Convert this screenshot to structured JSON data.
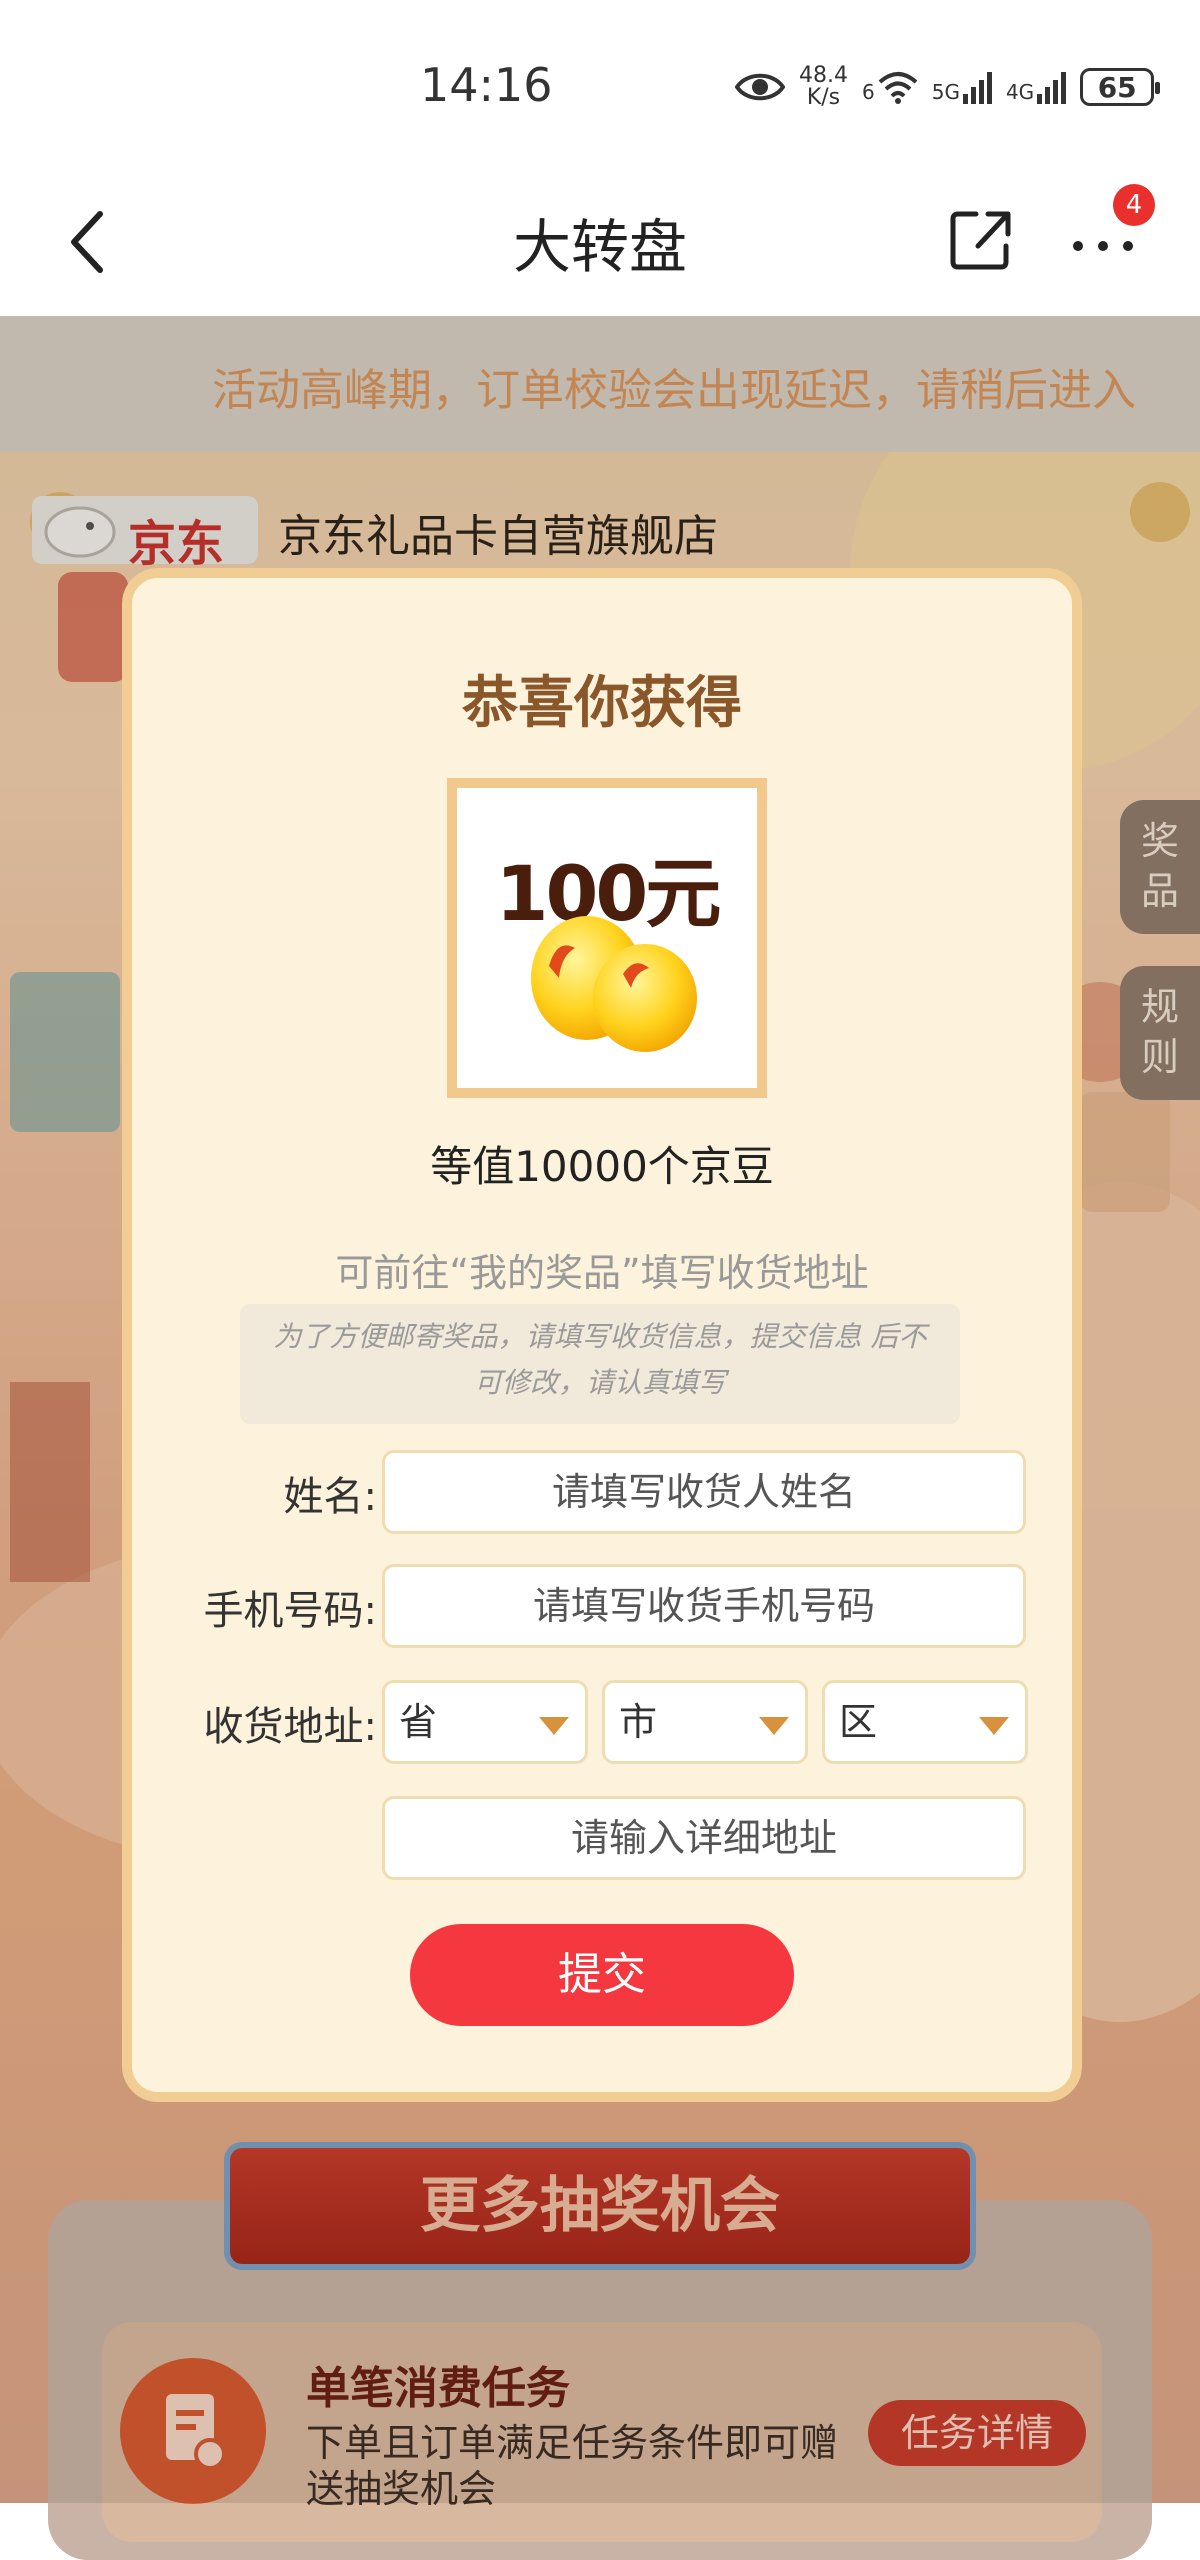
{
  "status_bar": {
    "time": "14:16",
    "net_speed_value": "48.4",
    "net_speed_unit": "K/s",
    "wifi_label": "6",
    "sim1_label": "5G",
    "sim2_label": "4G",
    "battery": "65"
  },
  "nav": {
    "title": "大转盘",
    "badge_count": "4"
  },
  "notice": {
    "text": "活动高峰期，订单校验会出现延迟，请稍后进入"
  },
  "store": {
    "logo_text": "京东",
    "name": "京东礼品卡自营旗舰店"
  },
  "side_tabs": {
    "prizes": "奖品",
    "rules": "规则"
  },
  "modal": {
    "title": "恭喜你获得",
    "prize_amount": "100元",
    "prize_desc": "等值10000个京豆",
    "hint": "可前往“我的奖品”填写收货地址",
    "notice": "为了方便邮寄奖品，请填写收货信息，提交信息 后不可修改，请认真填写",
    "form": {
      "name_label": "姓名:",
      "name_placeholder": "请填写收货人姓名",
      "phone_label": "手机号码:",
      "phone_placeholder": "请填写收货手机号码",
      "address_label": "收货地址:",
      "province": "省",
      "city": "市",
      "district": "区",
      "detail_placeholder": "请输入详细地址"
    },
    "submit_label": "提交"
  },
  "more_chances": {
    "banner": "更多抽奖机会",
    "task_title": "单笔消费任务",
    "task_desc": "下单且订单满足任务条件即可赠送抽奖机会",
    "task_button": "任务详情"
  },
  "colors": {
    "accent_red": "#f5373f",
    "modal_bg": "#fdf3dc",
    "modal_border": "#f1cd93",
    "title_brown": "#8a572a",
    "notice_orange": "#d9935a"
  }
}
